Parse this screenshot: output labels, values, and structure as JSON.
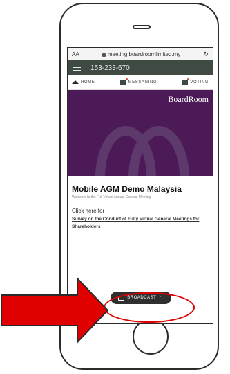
{
  "browser": {
    "text_size_label": "AA",
    "url": "meeting.boardroomlimited.my"
  },
  "app": {
    "meeting_id": "153-233-670",
    "tabs": [
      {
        "label": "HOME",
        "icon": "home-icon"
      },
      {
        "label": "MESSAGING",
        "icon": "messaging-icon"
      },
      {
        "label": "VOTING",
        "icon": "voting-icon"
      }
    ],
    "brand": "BoardRoom",
    "brand_tagline": "",
    "page_title": "Mobile AGM Demo Malaysia",
    "page_subtitle": "Welcome to the Full Virtual Annual General Meeting",
    "click_label": "Click here for",
    "survey_link": "Survey on the Conduct of Fully Virtual General Meetings for Shareholders",
    "broadcast_label": "BROADCAST"
  },
  "colors": {
    "topbar": "#3f4a42",
    "banner": "#4b1a57",
    "highlight": "#e00000"
  }
}
